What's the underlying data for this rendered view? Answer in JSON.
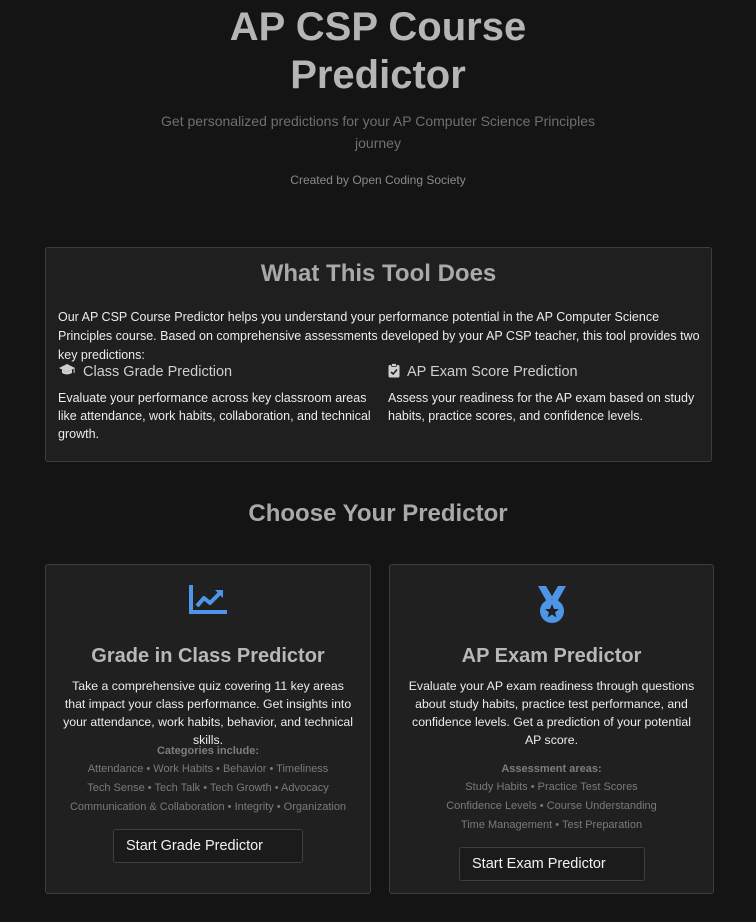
{
  "hero": {
    "title_line1": "AP CSP Course",
    "title_line2": "Predictor",
    "subtitle": "Get personalized predictions for your AP Computer Science Principles journey",
    "credit": "Created by Open Coding Society"
  },
  "about": {
    "title": "What This Tool Does",
    "intro": "Our AP CSP Course Predictor helps you understand your performance potential in the AP Computer Science Principles course. Based on comprehensive assessments developed by your AP CSP teacher, this tool provides two key predictions:",
    "class_grade": {
      "icon": "graduation-cap-icon",
      "title": "Class Grade Prediction",
      "text": "Evaluate your performance across key classroom areas like attendance, work habits, collaboration, and technical growth."
    },
    "ap_exam": {
      "icon": "clipboard-check-icon",
      "title": "AP Exam Score Prediction",
      "text": "Assess your readiness for the AP exam based on study habits, practice scores, and confidence levels."
    }
  },
  "choose": {
    "title": "Choose Your Predictor"
  },
  "grade_card": {
    "icon": "chart-line-icon",
    "title": "Grade in Class Predictor",
    "description": "Take a comprehensive quiz covering 11 key areas that impact your class performance. Get insights into your attendance, work habits, behavior, and technical skills.",
    "categories_title": "Categories include:",
    "categories": [
      "Attendance • Work Habits • Behavior • Timeliness",
      "Tech Sense • Tech Talk • Tech Growth • Advocacy",
      "Communication & Collaboration • Integrity • Organization"
    ],
    "button": "Start Grade Predictor"
  },
  "exam_card": {
    "icon": "medal-icon",
    "title": "AP Exam Predictor",
    "description": "Evaluate your AP exam readiness through questions about study habits, practice test performance, and confidence levels. Get a prediction of your potential AP score.",
    "areas_title": "Assessment areas:",
    "areas": [
      "Study Habits • Practice Test Scores",
      "Confidence Levels • Course Understanding",
      "Time Management • Test Preparation"
    ],
    "button": "Start Exam Predictor"
  },
  "colors": {
    "background": "#141414",
    "panel": "#1f1f1f",
    "accent_icon": "#4f95e6"
  }
}
